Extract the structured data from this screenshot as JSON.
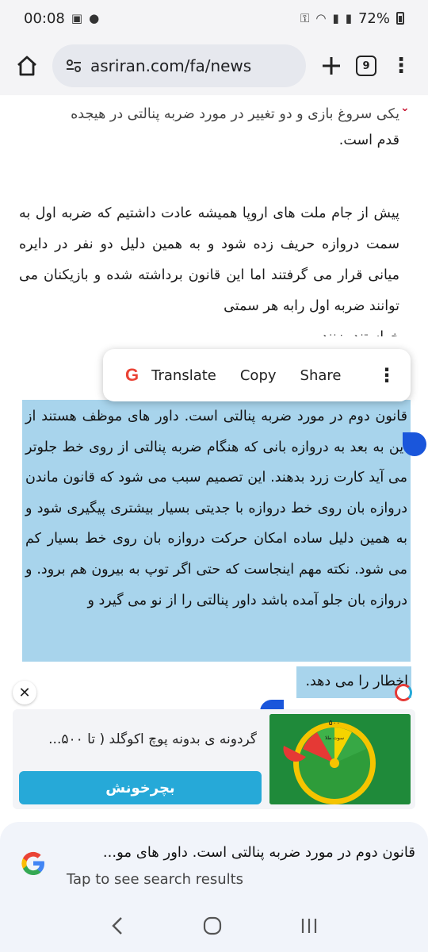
{
  "status_bar": {
    "time": "00:08",
    "battery": "72%"
  },
  "toolbar": {
    "url": "asriran.com/fa/news",
    "tab_count": "9"
  },
  "article": {
    "para1_line1": "یکی سروغ بازی و دو تغییر در مورد ضربه پنالتی در هیجده",
    "para1_line2": "قدم است.",
    "para2": "پیش از جام ملت های اروپا همیشه عادت داشتیم که ضربه اول به سمت دروازه حریف زده شود و به همین دلیل دو نفر در دایره میانی قرار می گرفتند اما این قانون برداشته شده و بازیکنان می توانند ضربه اول رابه هر سمتی",
    "para2_cut": "خواستند بزنند.",
    "selected": "قانون دوم در مورد ضربه پنالتی است. داور های موظف هستند از این به بعد به دروازه بانی که هنگام ضربه پنالتی از روی خط جلوتر می آید کارت زرد بدهند. این تصمیم سبب می شود که قانون ماندن دروازه بان روی خط دروازه با جدیتی بسیار بیشتری پیگیری شود و به همین دلیل ساده امکان حرکت دروازه بان روی خط بسیار کم می شود. نکته مهم اینجاست که حتی اگر توپ به بیرون هم برود. و دروازه بان جلو آمده باشد داور پنالتی را از نو می گیرد و",
    "selected_last": "اخطار را می دهد."
  },
  "popup": {
    "translate": "Translate",
    "copy": "Copy",
    "share": "Share"
  },
  "ad": {
    "title": "گردونه ی بدونه پوچ اکوگلد ( تا ۵۰۰...",
    "button": "بچرخونش",
    "wheel_top": "۵۰۰",
    "wheel_sub": "سوت طلا"
  },
  "bottom_sheet": {
    "query": "قانون دوم در مورد ضربه پنالتی است. داور های مو...",
    "hint": "Tap to see search results"
  },
  "colors": {
    "selection": "#a8d4ec",
    "handle": "#1a56db",
    "ad_button": "#26a9d8"
  }
}
